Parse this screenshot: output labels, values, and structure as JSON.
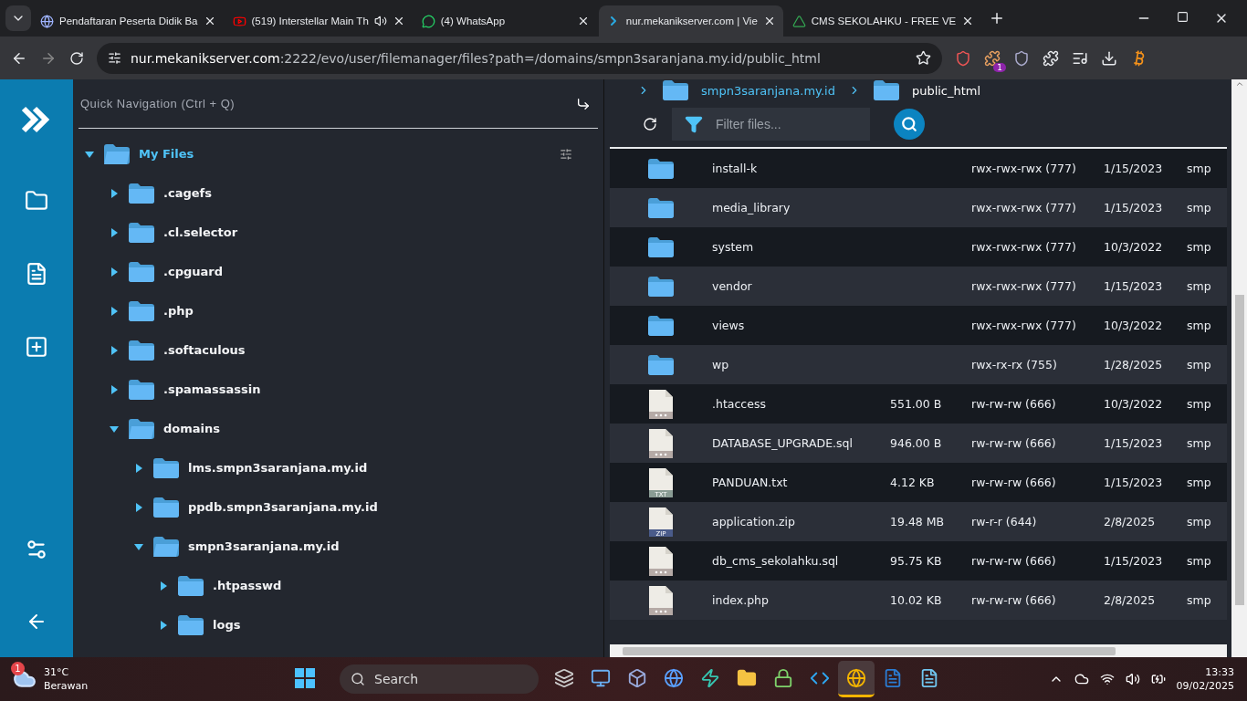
{
  "browser": {
    "tabs": [
      {
        "title": "Pendaftaran Peserta Didik Ba",
        "selected": false,
        "audio": false
      },
      {
        "title": "(519) Interstellar Main Th",
        "selected": false,
        "audio": true
      },
      {
        "title": "(4) WhatsApp",
        "selected": false,
        "audio": false
      },
      {
        "title": "nur.mekanikserver.com | Vie",
        "selected": true,
        "audio": false
      },
      {
        "title": "CMS SEKOLAHKU - FREE VE",
        "selected": false,
        "audio": false
      }
    ],
    "address": {
      "host": "nur.mekanikserver.com",
      "path": ":2222/evo/user/filemanager/files?path=/domains/smpn3saranjana.my.id/public_html"
    },
    "extension_badge": "1"
  },
  "quick_nav": {
    "placeholder": "Quick Navigation (Ctrl + Q)"
  },
  "tree": [
    {
      "name": "My Files",
      "expanded": true,
      "selected": true,
      "children": [
        {
          "name": ".cagefs",
          "expanded": false,
          "selected": false
        },
        {
          "name": ".cl.selector",
          "expanded": false,
          "selected": false
        },
        {
          "name": ".cpguard",
          "expanded": false,
          "selected": false
        },
        {
          "name": ".php",
          "expanded": false,
          "selected": false
        },
        {
          "name": ".softaculous",
          "expanded": false,
          "selected": false
        },
        {
          "name": ".spamassassin",
          "expanded": false,
          "selected": false
        },
        {
          "name": "domains",
          "expanded": true,
          "selected": false,
          "children": [
            {
              "name": "lms.smpn3saranjana.my.id",
              "expanded": false,
              "selected": false
            },
            {
              "name": "ppdb.smpn3saranjana.my.id",
              "expanded": false,
              "selected": false
            },
            {
              "name": "smpn3saranjana.my.id",
              "expanded": true,
              "selected": false,
              "children": [
                {
                  "name": ".htpasswd",
                  "expanded": false,
                  "selected": false
                },
                {
                  "name": "logs",
                  "expanded": false,
                  "selected": false
                }
              ]
            }
          ]
        }
      ]
    }
  ],
  "breadcrumb": [
    "smpn3saranjana.my.id",
    "public_html"
  ],
  "filter": {
    "placeholder": "Filter files..."
  },
  "files": [
    {
      "kind": "folder",
      "name": "install-k",
      "permissions": "rwx-rwx-rwx (777)",
      "date": "1/15/2023",
      "owner": "smp"
    },
    {
      "kind": "folder",
      "name": "media_library",
      "permissions": "rwx-rwx-rwx (777)",
      "date": "1/15/2023",
      "owner": "smp"
    },
    {
      "kind": "folder",
      "name": "system",
      "permissions": "rwx-rwx-rwx (777)",
      "date": "10/3/2022",
      "owner": "smp"
    },
    {
      "kind": "folder",
      "name": "vendor",
      "permissions": "rwx-rwx-rwx (777)",
      "date": "1/15/2023",
      "owner": "smp"
    },
    {
      "kind": "folder",
      "name": "views",
      "permissions": "rwx-rwx-rwx (777)",
      "date": "10/3/2022",
      "owner": "smp"
    },
    {
      "kind": "folder",
      "name": "wp",
      "permissions": "rwx-rx-rx (755)",
      "date": "1/28/2025",
      "owner": "smp"
    },
    {
      "kind": "file",
      "name": ".htaccess",
      "size": "551.00 B",
      "permissions": "rw-rw-rw (666)",
      "date": "10/3/2022",
      "owner": "smp"
    },
    {
      "kind": "file",
      "name": "DATABASE_UPGRADE.sql",
      "size": "946.00 B",
      "permissions": "rw-rw-rw (666)",
      "date": "1/15/2023",
      "owner": "smp"
    },
    {
      "kind": "text",
      "badge": "TXT",
      "name": "PANDUAN.txt",
      "size": "4.12 KB",
      "permissions": "rw-rw-rw (666)",
      "date": "1/15/2023",
      "owner": "smp"
    },
    {
      "kind": "archive",
      "badge": "ZIP",
      "name": "application.zip",
      "size": "19.48 MB",
      "permissions": "rw-r-r (644)",
      "date": "2/8/2025",
      "owner": "smp"
    },
    {
      "kind": "file",
      "name": "db_cms_sekolahku.sql",
      "size": "95.75 KB",
      "permissions": "rw-rw-rw (666)",
      "date": "1/15/2023",
      "owner": "smp"
    },
    {
      "kind": "file",
      "name": "index.php",
      "size": "10.02 KB",
      "permissions": "rw-rw-rw (666)",
      "date": "2/8/2025",
      "owner": "smp"
    }
  ],
  "taskbar": {
    "weather": {
      "temp": "31°C",
      "condition": "Berawan",
      "badge": "1"
    },
    "search": "Search",
    "apps": [
      {
        "active": false
      },
      {
        "active": false
      },
      {
        "active": false
      },
      {
        "active": false
      },
      {
        "active": false
      },
      {
        "active": false
      },
      {
        "active": false
      },
      {
        "active": false
      },
      {
        "active": false
      },
      {
        "active": true
      },
      {
        "active": false
      },
      {
        "active": false
      }
    ],
    "time": "13:33",
    "date": "09/02/2025"
  }
}
